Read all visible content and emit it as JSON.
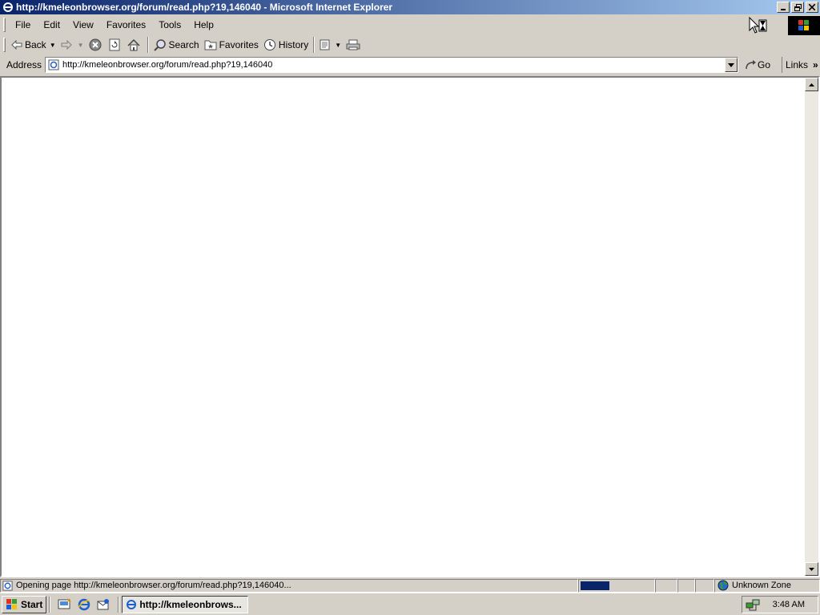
{
  "window": {
    "title": "http://kmeleonbrowser.org/forum/read.php?19,146040 - Microsoft Internet Explorer"
  },
  "menu": [
    "File",
    "Edit",
    "View",
    "Favorites",
    "Tools",
    "Help"
  ],
  "toolbar": {
    "back": "Back",
    "search": "Search",
    "favorites": "Favorites",
    "history": "History"
  },
  "address": {
    "label": "Address",
    "url": "http://kmeleonbrowser.org/forum/read.php?19,146040",
    "go": "Go",
    "links": "Links"
  },
  "status": {
    "text": "Opening page http://kmeleonbrowser.org/forum/read.php?19,146040...",
    "progress": 0.4,
    "zone": "Unknown Zone"
  },
  "taskbar": {
    "start": "Start",
    "task": "http://kmeleonbrows...",
    "clock": "3:48 AM"
  },
  "colors": {
    "titlebar_start": "#0a246a",
    "titlebar_end": "#a6caf0",
    "chrome": "#d4d0c8",
    "progress": "#0a246a"
  }
}
